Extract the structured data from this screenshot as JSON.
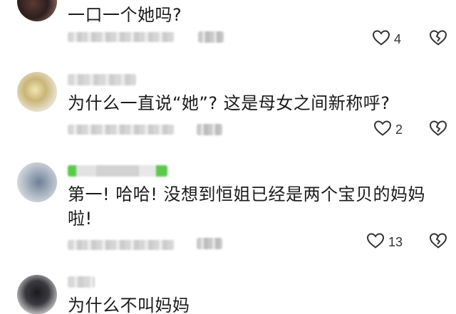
{
  "comments": [
    {
      "text": "一口一个她吗?",
      "likes": "4"
    },
    {
      "text": "为什么一直说“她”? 这是母女之间新称呼?",
      "likes": "2"
    },
    {
      "text": "第一! 哈哈! 没想到恒姐已经是两个宝贝的妈妈啦!",
      "likes": "13"
    },
    {
      "text": "为什么不叫妈妈",
      "likes": ""
    }
  ],
  "icons": {
    "like": "heart-outline-icon",
    "dislike": "broken-heart-icon"
  },
  "colors": {
    "text": "#1a1a1a",
    "icon": "#333333",
    "badge_green": "#5bc94a"
  }
}
